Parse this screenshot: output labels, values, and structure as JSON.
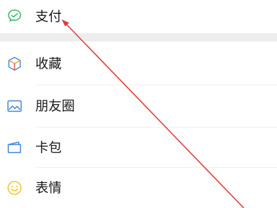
{
  "menu": {
    "items": [
      {
        "label": "支付",
        "icon": "wechat-pay-icon"
      },
      {
        "label": "收藏",
        "icon": "favorites-cube-icon"
      },
      {
        "label": "朋友圈",
        "icon": "moments-photo-icon"
      },
      {
        "label": "卡包",
        "icon": "card-wallet-icon"
      },
      {
        "label": "表情",
        "icon": "sticker-smile-icon"
      }
    ]
  },
  "colors": {
    "pay_green": "#3bb86a",
    "favorites_orange": "#f3a23a",
    "favorites_blue": "#4c8de0",
    "moments_blue": "#3d83d4",
    "card_blue": "#3d86d8",
    "sticker_yellow": "#f4c22b",
    "section_gap": "#ededed",
    "annotation_red": "#e53935"
  },
  "annotation": {
    "type": "red-arrow",
    "points_to": "支付"
  }
}
